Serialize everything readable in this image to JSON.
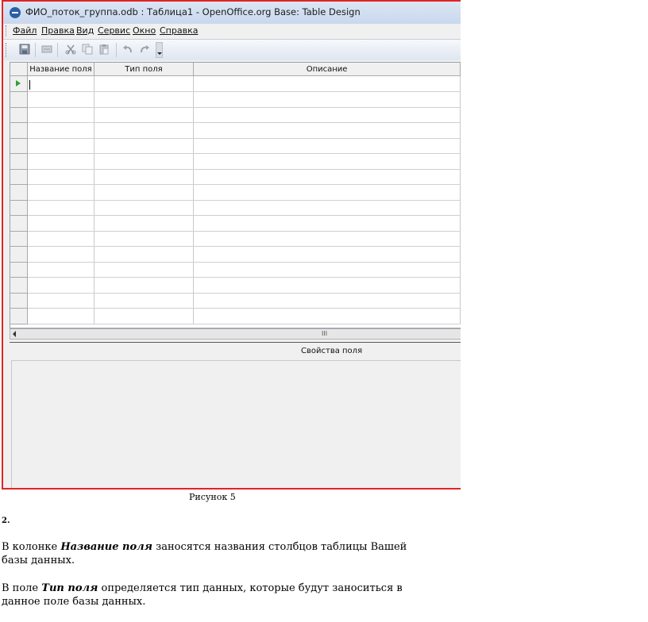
{
  "window": {
    "title": "ФИО_поток_группа.odb : Таблица1 - OpenOffice.org Base: Table Design"
  },
  "menu": {
    "items": [
      "Файл",
      "Правка",
      "Вид",
      "Сервис",
      "Окно",
      "Справка"
    ]
  },
  "toolbar": {
    "icons": [
      "save-icon",
      "edit-icon",
      "cut-icon",
      "copy-icon",
      "paste-icon",
      "undo-icon",
      "redo-icon"
    ]
  },
  "grid": {
    "columns": [
      "Название поля",
      "Тип поля",
      "Описание"
    ],
    "row_count": 16
  },
  "scrollbar": {
    "grip": "III"
  },
  "properties": {
    "title": "Свойства поля"
  },
  "doc": {
    "caption": "Рисунок 5",
    "step_number": "2.",
    "p1_prefix": "В колонке ",
    "p1_bold": "Название поля",
    "p1_rest": " заносятся названия столбцов таблицы Вашей базы данных.",
    "p2_prefix": "В поле ",
    "p2_bold": "Тип поля",
    "p2_rest": " определяется тип данных, которые будут заноситься в данное поле базы данных."
  },
  "colors": {
    "frame_border": "#e02424",
    "current_row_marker": "#2fa12f"
  }
}
